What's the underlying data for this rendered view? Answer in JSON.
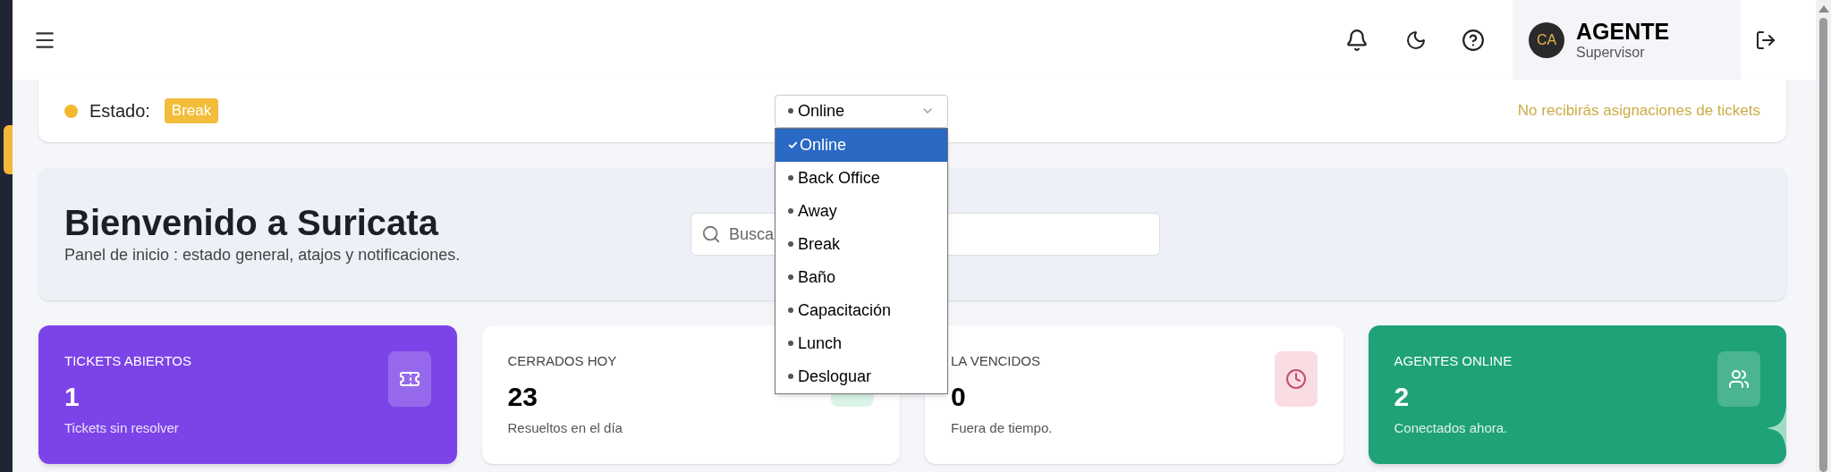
{
  "header": {
    "user": {
      "initials": "CA",
      "name": "AGENTE",
      "role": "Supervisor"
    }
  },
  "status": {
    "label": "Estado:",
    "badge": "Break",
    "value": "Online",
    "note": "No recibirás asignaciones de tickets",
    "dropdown": {
      "expanded": true,
      "options": [
        {
          "label": "Online",
          "selected": true
        },
        {
          "label": "Back Office",
          "selected": false
        },
        {
          "label": "Away",
          "selected": false
        },
        {
          "label": "Break",
          "selected": false
        },
        {
          "label": "Baño",
          "selected": false
        },
        {
          "label": "Capacitación",
          "selected": false
        },
        {
          "label": "Lunch",
          "selected": false
        },
        {
          "label": "Desloguar",
          "selected": false
        }
      ]
    }
  },
  "welcome": {
    "title": "Bienvenido a Suricata",
    "subtitle": "Panel de inicio : estado general, atajos y notificaciones.",
    "search_placeholder": "Busca"
  },
  "cards": [
    {
      "kind": "filled",
      "color": "#7c44e8",
      "title": "TICKETS ABIERTOS",
      "value": "1",
      "caption": "Tickets sin resolver"
    },
    {
      "kind": "plain",
      "color": "#dcf5e9",
      "title": "CERRADOS HOY",
      "value": "23",
      "caption": "Resueltos en el día"
    },
    {
      "kind": "plain",
      "color": "#fadde3",
      "title": "LA VENCIDOS",
      "value": "0",
      "caption": "Fuera de tiempo."
    },
    {
      "kind": "filled",
      "color": "#1fa277",
      "title": "AGENTES ONLINE",
      "value": "2",
      "caption": "Conectados ahora."
    }
  ]
}
